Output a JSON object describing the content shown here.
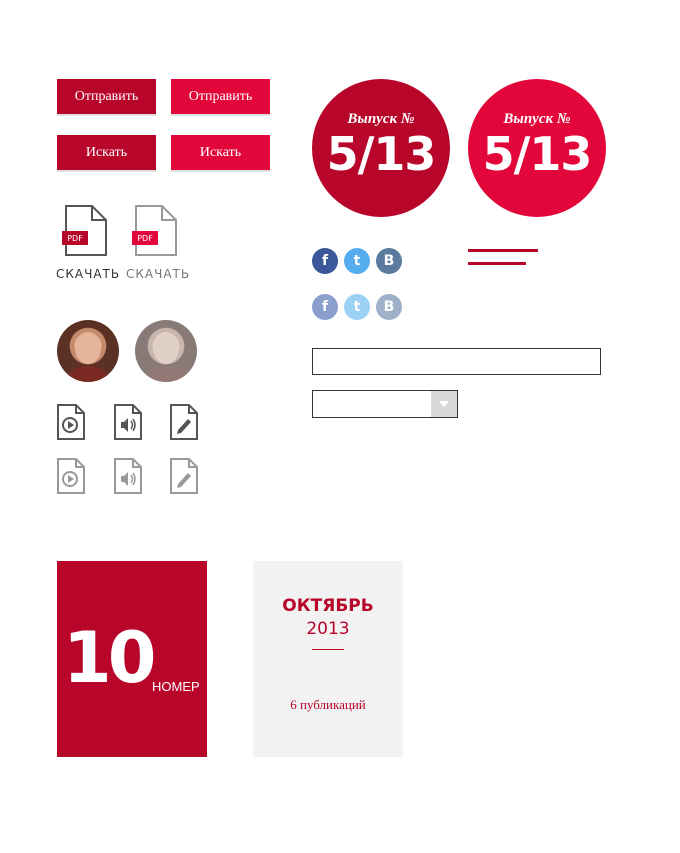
{
  "buttons": {
    "send_label": "Отправить",
    "search_label": "Искать"
  },
  "downloads": {
    "pdf_badge": "PDF",
    "label": "СКАЧАТЬ"
  },
  "issue": {
    "label": "Выпуск №",
    "number": "5/13"
  },
  "social": {
    "facebook": "f",
    "twitter": "t",
    "vk": "B"
  },
  "form": {
    "input_value": "",
    "select_value": ""
  },
  "tile": {
    "number": "10",
    "suffix": "НОМЕР",
    "month": "ОКТЯБРЬ",
    "year": "2013",
    "publications": "6 публикаций"
  },
  "colors": {
    "dark_red": "#b8052a",
    "bright_red": "#e3063a",
    "facebook": "#3b5998",
    "twitter": "#55acee",
    "vk": "#5b7aa0"
  },
  "icons": [
    "pdf-file-icon",
    "play-file-icon",
    "audio-file-icon",
    "edit-file-icon",
    "facebook-icon",
    "twitter-icon",
    "vk-icon",
    "chevron-down-icon"
  ]
}
